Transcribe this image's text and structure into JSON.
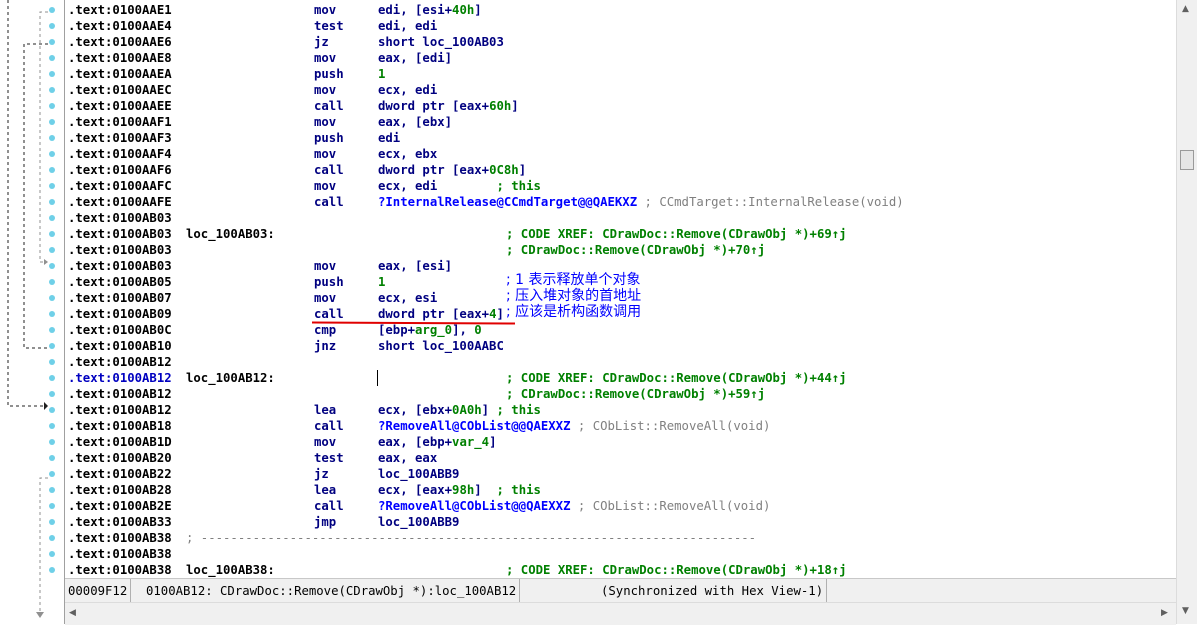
{
  "listing": {
    "rows": [
      {
        "addr": ".text:0100AAE1",
        "mnem": "mov",
        "ops": [
          {
            "t": "edi, [esi+"
          },
          {
            "t": "40h",
            "c": "num"
          },
          {
            "t": "]"
          }
        ]
      },
      {
        "addr": ".text:0100AAE4",
        "mnem": "test",
        "ops": [
          {
            "t": "edi, edi"
          }
        ]
      },
      {
        "addr": ".text:0100AAE6",
        "mnem": "jz",
        "ops": [
          {
            "t": "short loc_100AB03"
          }
        ]
      },
      {
        "addr": ".text:0100AAE8",
        "mnem": "mov",
        "ops": [
          {
            "t": "eax, [edi]"
          }
        ]
      },
      {
        "addr": ".text:0100AAEA",
        "mnem": "push",
        "ops": [
          {
            "t": "1",
            "c": "num"
          }
        ]
      },
      {
        "addr": ".text:0100AAEC",
        "mnem": "mov",
        "ops": [
          {
            "t": "ecx, edi"
          }
        ]
      },
      {
        "addr": ".text:0100AAEE",
        "mnem": "call",
        "ops": [
          {
            "t": "dword ptr [eax+"
          },
          {
            "t": "60h",
            "c": "num"
          },
          {
            "t": "]"
          }
        ]
      },
      {
        "addr": ".text:0100AAF1",
        "mnem": "mov",
        "ops": [
          {
            "t": "eax, [ebx]"
          }
        ]
      },
      {
        "addr": ".text:0100AAF3",
        "mnem": "push",
        "ops": [
          {
            "t": "edi"
          }
        ]
      },
      {
        "addr": ".text:0100AAF4",
        "mnem": "mov",
        "ops": [
          {
            "t": "ecx, ebx"
          }
        ]
      },
      {
        "addr": ".text:0100AAF6",
        "mnem": "call",
        "ops": [
          {
            "t": "dword ptr [eax+"
          },
          {
            "t": "0C8h",
            "c": "num"
          },
          {
            "t": "]"
          }
        ]
      },
      {
        "addr": ".text:0100AAFC",
        "mnem": "mov",
        "ops": [
          {
            "t": "ecx, edi        "
          },
          {
            "t": "; this",
            "c": "xrefc"
          }
        ]
      },
      {
        "addr": ".text:0100AAFE",
        "mnem": "call",
        "ops": [
          {
            "t": "?InternalRelease@CCmdTarget@@QAEKXZ",
            "c": "fn"
          },
          {
            "t": " ; CCmdTarget::InternalRelease(void)",
            "c": "gray"
          }
        ]
      },
      {
        "addr": ".text:0100AB03"
      },
      {
        "addr": ".text:0100AB03",
        "label": "loc_100AB03:",
        "xref": "; CODE XREF: CDrawDoc::Remove(CDrawObj *)+69↑j"
      },
      {
        "addr": ".text:0100AB03",
        "xref": "; CDrawDoc::Remove(CDrawObj *)+70↑j"
      },
      {
        "addr": ".text:0100AB03",
        "mnem": "mov",
        "ops": [
          {
            "t": "eax, [esi]"
          }
        ]
      },
      {
        "addr": ".text:0100AB05",
        "mnem": "push",
        "ops": [
          {
            "t": "1",
            "c": "num"
          }
        ],
        "note": "; 1 表示释放单个对象"
      },
      {
        "addr": ".text:0100AB07",
        "mnem": "mov",
        "ops": [
          {
            "t": "ecx, esi"
          }
        ],
        "note": "; 压入堆对象的首地址"
      },
      {
        "addr": ".text:0100AB09",
        "mnem": "call",
        "ops": [
          {
            "t": "dword ptr [eax+"
          },
          {
            "t": "4",
            "c": "num"
          },
          {
            "t": "]"
          }
        ],
        "note": "; 应该是析构函数调用"
      },
      {
        "addr": ".text:0100AB0C",
        "mnem": "cmp",
        "ops": [
          {
            "t": "[ebp+"
          },
          {
            "t": "arg_0",
            "c": "var"
          },
          {
            "t": "], "
          },
          {
            "t": "0",
            "c": "num"
          }
        ]
      },
      {
        "addr": ".text:0100AB10",
        "mnem": "jnz",
        "ops": [
          {
            "t": "short loc_100AABC"
          }
        ]
      },
      {
        "addr": ".text:0100AB12"
      },
      {
        "addr": ".text:0100AB12",
        "blue": true,
        "label": "loc_100AB12:",
        "xref": "; CODE XREF: CDrawDoc::Remove(CDrawObj *)+44↑j"
      },
      {
        "addr": ".text:0100AB12",
        "xref": "; CDrawDoc::Remove(CDrawObj *)+59↑j"
      },
      {
        "addr": ".text:0100AB12",
        "mnem": "lea",
        "ops": [
          {
            "t": "ecx, [ebx+"
          },
          {
            "t": "0A0h",
            "c": "num"
          },
          {
            "t": "] "
          },
          {
            "t": "; this",
            "c": "xrefc"
          }
        ]
      },
      {
        "addr": ".text:0100AB18",
        "mnem": "call",
        "ops": [
          {
            "t": "?RemoveAll@CObList@@QAEXXZ",
            "c": "fn"
          },
          {
            "t": " ; CObList::RemoveAll(void)",
            "c": "gray"
          }
        ]
      },
      {
        "addr": ".text:0100AB1D",
        "mnem": "mov",
        "ops": [
          {
            "t": "eax, [ebp+"
          },
          {
            "t": "var_4",
            "c": "var"
          },
          {
            "t": "]"
          }
        ]
      },
      {
        "addr": ".text:0100AB20",
        "mnem": "test",
        "ops": [
          {
            "t": "eax, eax"
          }
        ]
      },
      {
        "addr": ".text:0100AB22",
        "mnem": "jz",
        "ops": [
          {
            "t": "loc_100ABB9"
          }
        ]
      },
      {
        "addr": ".text:0100AB28",
        "mnem": "lea",
        "ops": [
          {
            "t": "ecx, [eax+"
          },
          {
            "t": "98h",
            "c": "num"
          },
          {
            "t": "]  "
          },
          {
            "t": "; this",
            "c": "xrefc"
          }
        ]
      },
      {
        "addr": ".text:0100AB2E",
        "mnem": "call",
        "ops": [
          {
            "t": "?RemoveAll@CObList@@QAEXXZ",
            "c": "fn"
          },
          {
            "t": " ; CObList::RemoveAll(void)",
            "c": "gray"
          }
        ]
      },
      {
        "addr": ".text:0100AB33",
        "mnem": "jmp",
        "ops": [
          {
            "t": "loc_100ABB9"
          }
        ]
      },
      {
        "addr": ".text:0100AB38",
        "sep": "; ---------------------------------------------------------------------------"
      },
      {
        "addr": ".text:0100AB38"
      },
      {
        "addr": ".text:0100AB38",
        "label": "loc_100AB38:",
        "xref": "; CODE XREF: CDrawDoc::Remove(CDrawObj *)+18↑j"
      }
    ]
  },
  "status": {
    "offset": "00009F12",
    "location": "0100AB12: CDrawDoc::Remove(CDrawObj *):loc_100AB12",
    "sync": "(Synchronized with Hex View-1)"
  },
  "colors": {
    "address": "#000000",
    "mnemonic": "#000080",
    "number": "#008000",
    "xref": "#008000",
    "function": "#0000ff",
    "comment": "#808080",
    "annotation": "#0000ff",
    "underline": "#e00000"
  }
}
